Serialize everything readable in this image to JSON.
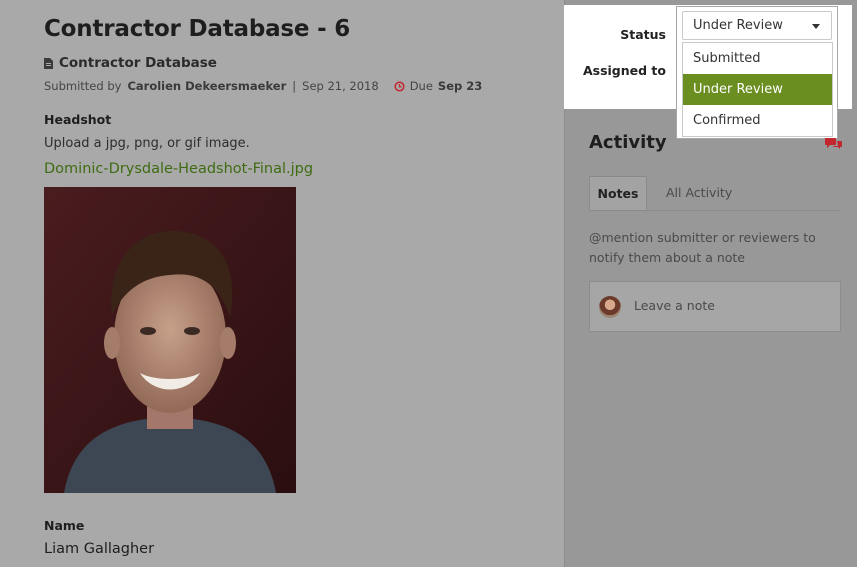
{
  "header": {
    "title": "Contractor Database - 6",
    "form_name": "Contractor Database",
    "submitted_by_label": "Submitted by",
    "submitter": "Carolien Dekeersmaeker",
    "separator": "|",
    "submitted_date": "Sep 21, 2018",
    "due_label": "Due",
    "due_date": "Sep 23"
  },
  "fields": {
    "headshot": {
      "label": "Headshot",
      "help": "Upload a jpg, png, or gif image.",
      "file_name": "Dominic-Drysdale-Headshot-Final.jpg"
    },
    "name": {
      "label": "Name",
      "value": "Liam Gallagher"
    }
  },
  "status_panel": {
    "status_label": "Status",
    "assigned_label": "Assigned to",
    "selected": "Under Review",
    "options": [
      "Submitted",
      "Under Review",
      "Confirmed"
    ]
  },
  "activity": {
    "title": "Activity",
    "tabs": [
      "Notes",
      "All Activity"
    ],
    "mention_help": "@mention submitter or reviewers to notify them about a note",
    "note_placeholder": "Leave a note"
  },
  "colors": {
    "accent_green": "#6a8e1f",
    "link_green": "#3e6c12",
    "alert_red": "#c4262e"
  }
}
